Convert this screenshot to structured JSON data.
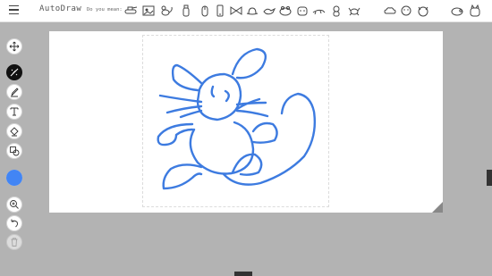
{
  "header": {
    "app_title": "AutoDraw",
    "suggest_label": "Do you mean:",
    "menu_icon": "hamburger-menu-icon",
    "suggestions": [
      {
        "icon": "tank-icon"
      },
      {
        "icon": "photo-icon"
      },
      {
        "icon": "mouse-doodle-icon"
      },
      {
        "icon": "bottle-icon"
      },
      {
        "icon": "computer-mouse-icon"
      },
      {
        "icon": "phone-icon"
      },
      {
        "icon": "bowtie-icon"
      },
      {
        "icon": "hat-icon"
      },
      {
        "icon": "bird-icon"
      },
      {
        "icon": "frog-icon"
      },
      {
        "icon": "cow-face-icon"
      },
      {
        "icon": "lizard-icon"
      },
      {
        "icon": "bear-icon"
      },
      {
        "icon": "crab-icon"
      },
      {
        "icon": "cloud-icon"
      },
      {
        "icon": "face-icon"
      },
      {
        "icon": "cat-face-icon"
      },
      {
        "icon": "pig-icon"
      },
      {
        "icon": "cat-icon"
      }
    ]
  },
  "toolbar": {
    "tools": [
      {
        "name": "select",
        "icon": "move-arrows-icon"
      },
      {
        "name": "autodraw",
        "icon": "autodraw-icon",
        "active": true
      },
      {
        "name": "draw",
        "icon": "pencil-icon"
      },
      {
        "name": "type",
        "icon": "text-tool-icon"
      },
      {
        "name": "fill",
        "icon": "fill-bucket-icon"
      },
      {
        "name": "shape",
        "icon": "shapes-icon"
      },
      {
        "name": "color",
        "icon": "color-swatch",
        "color": "#4285f4"
      },
      {
        "name": "zoom",
        "icon": "zoom-in-icon"
      },
      {
        "name": "undo",
        "icon": "undo-icon"
      },
      {
        "name": "delete",
        "icon": "trash-icon",
        "disabled": true
      }
    ]
  },
  "canvas": {
    "stroke_color": "#3d7be0",
    "background": "#ffffff"
  }
}
